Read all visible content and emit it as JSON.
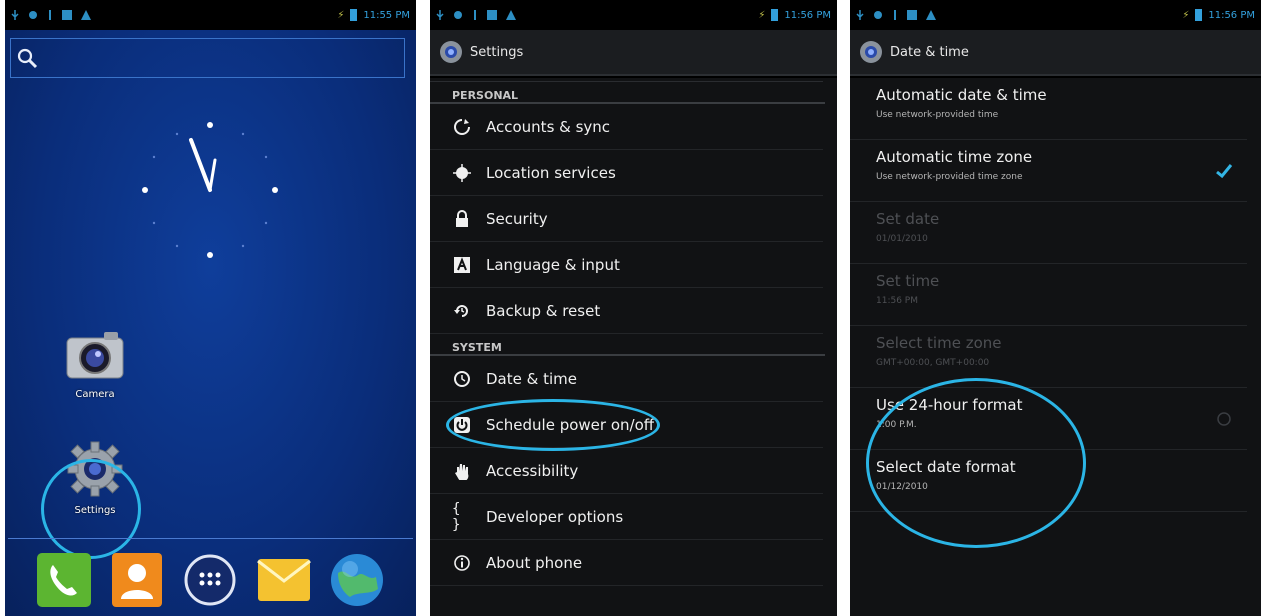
{
  "status": {
    "time1": "11:55 PM",
    "time2": "11:56 PM",
    "time3": "11:56 PM"
  },
  "home": {
    "search_placeholder": "",
    "apps": [
      {
        "label": "Camera",
        "icon": "camera-icon"
      },
      {
        "label": "Settings",
        "icon": "gear-icon"
      }
    ],
    "dock": [
      "phone-icon",
      "contacts-icon",
      "app-drawer-icon",
      "email-icon",
      "browser-icon"
    ]
  },
  "settings": {
    "title": "Settings",
    "section_personal": "PERSONAL",
    "section_system": "SYSTEM",
    "personal_items": [
      {
        "label": "Accounts & sync",
        "icon": "sync-icon"
      },
      {
        "label": "Location services",
        "icon": "location-icon"
      },
      {
        "label": "Security",
        "icon": "lock-icon"
      },
      {
        "label": "Language & input",
        "icon": "keyboard-icon"
      },
      {
        "label": "Backup & reset",
        "icon": "backup-icon"
      }
    ],
    "system_items": [
      {
        "label": "Date & time",
        "icon": "clock-icon"
      },
      {
        "label": "Schedule power on/off",
        "icon": "power-icon"
      },
      {
        "label": "Accessibility",
        "icon": "hand-icon"
      },
      {
        "label": "Developer options",
        "icon": "braces-icon"
      },
      {
        "label": "About phone",
        "icon": "info-icon"
      }
    ]
  },
  "datetime": {
    "title": "Date & time",
    "prefs": [
      {
        "title": "Automatic date & time",
        "summary": "Use network-provided time",
        "enabled": true,
        "checkbox": "none"
      },
      {
        "title": "Automatic time zone",
        "summary": "Use network-provided time zone",
        "enabled": true,
        "checkbox": "checked"
      },
      {
        "title": "Set date",
        "summary": "01/01/2010",
        "enabled": false,
        "checkbox": "none"
      },
      {
        "title": "Set time",
        "summary": "11:56 PM",
        "enabled": false,
        "checkbox": "none"
      },
      {
        "title": "Select time zone",
        "summary": "GMT+00:00, GMT+00:00",
        "enabled": false,
        "checkbox": "none"
      },
      {
        "title": "Use 24-hour format",
        "summary": "1:00 P.M.",
        "enabled": true,
        "checkbox": "unchecked"
      },
      {
        "title": "Select date format",
        "summary": "01/12/2010",
        "enabled": true,
        "checkbox": "none"
      }
    ]
  },
  "colors": {
    "accent": "#33a0dc",
    "highlight_circle": "#2bb5e6",
    "home_bg": "#0a2d7a",
    "settings_bg": "#111214"
  }
}
